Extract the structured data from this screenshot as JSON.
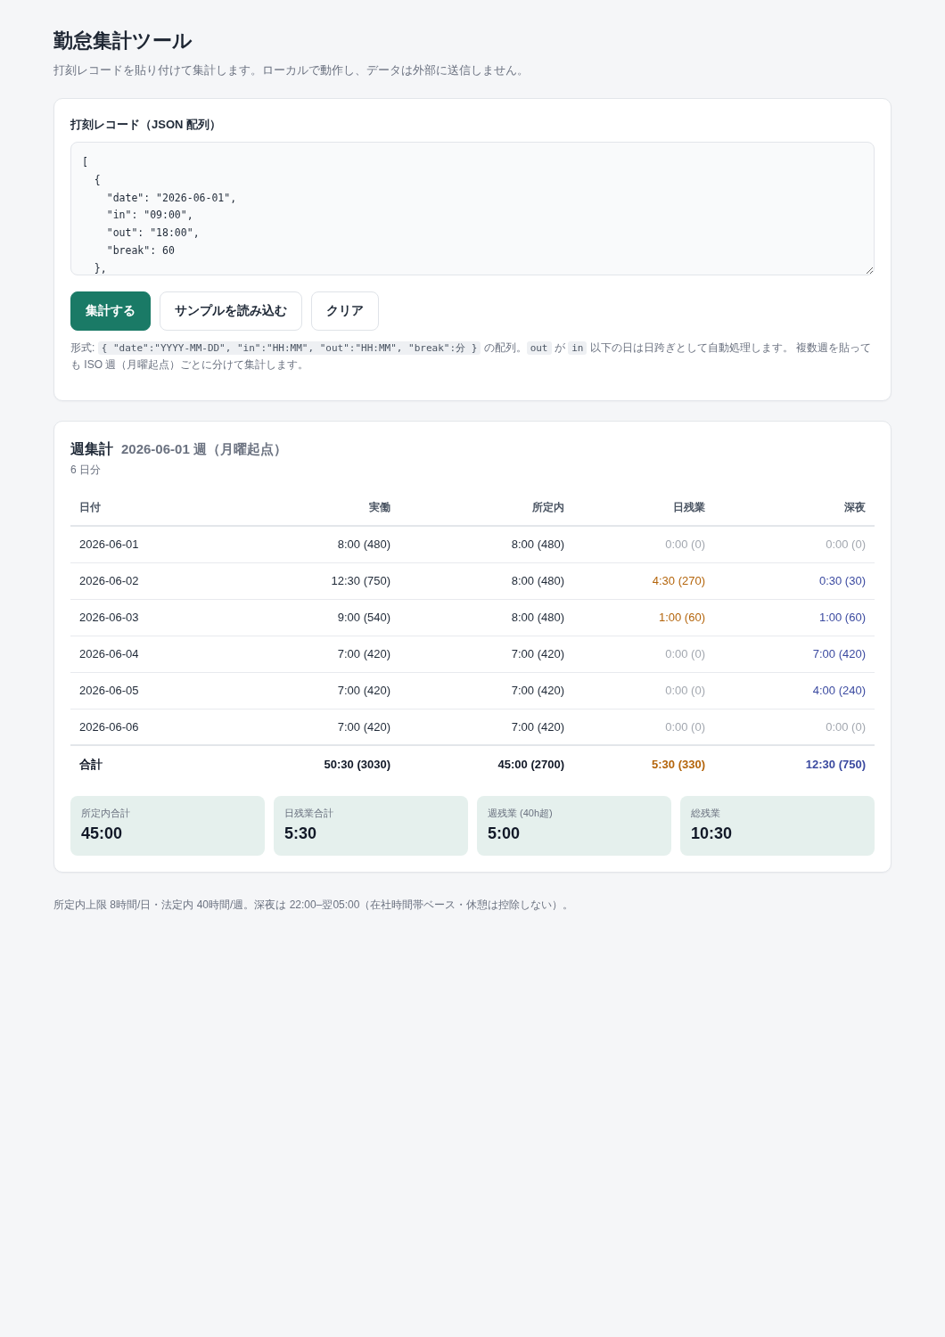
{
  "page": {
    "title": "勤怠集計ツール",
    "subtitle": "打刻レコードを貼り付けて集計します。ローカルで動作し、データは外部に送信しません。"
  },
  "input_card": {
    "label": "打刻レコード（JSON 配列）",
    "records_field": {
      "value": "[\n  {\n    \"date\": \"2026-06-01\",\n    \"in\": \"09:00\",\n    \"out\": \"18:00\",\n    \"break\": 60\n  },"
    },
    "buttons": [
      {
        "label": "集計する",
        "kind": "primary"
      },
      {
        "label": "サンプルを読み込む",
        "kind": "secondary"
      },
      {
        "label": "クリア",
        "kind": "secondary"
      }
    ],
    "hint": [
      {
        "text": "形式: ",
        "kind": "plain"
      },
      {
        "text": "{ \"date\":\"YYYY-MM-DD\", \"in\":\"HH:MM\", \"out\":\"HH:MM\", \"break\":分 }",
        "kind": "code"
      },
      {
        "text": " の配列。",
        "kind": "plain"
      },
      {
        "text": "out",
        "kind": "code"
      },
      {
        "text": " が ",
        "kind": "plain"
      },
      {
        "text": "in",
        "kind": "code"
      },
      {
        "text": " 以下の日は日跨ぎとして自動処理します。 複数週を貼っても ISO 週（月曜起点）ごとに分けて集計します。",
        "kind": "plain"
      }
    ]
  },
  "summary_card": {
    "title": "週集計",
    "week": "2026-06-01 週（月曜起点）",
    "day_count": "6 日分",
    "table": {
      "columns": [
        {
          "label": "日付",
          "kind": "date"
        },
        {
          "label": "実働",
          "kind": "number"
        },
        {
          "label": "所定内",
          "kind": "number"
        },
        {
          "label": "日残業",
          "kind": "overtime"
        },
        {
          "label": "深夜",
          "kind": "night"
        }
      ],
      "rows": [
        {
          "cells": [
            {
              "text": "2026-06-01",
              "muted": false
            },
            {
              "text": "8:00 (480)",
              "muted": false
            },
            {
              "text": "8:00 (480)",
              "muted": false
            },
            {
              "text": "0:00 (0)",
              "muted": true
            },
            {
              "text": "0:00 (0)",
              "muted": true
            }
          ]
        },
        {
          "cells": [
            {
              "text": "2026-06-02",
              "muted": false
            },
            {
              "text": "12:30 (750)",
              "muted": false
            },
            {
              "text": "8:00 (480)",
              "muted": false
            },
            {
              "text": "4:30 (270)",
              "muted": false
            },
            {
              "text": "0:30 (30)",
              "muted": false
            }
          ]
        },
        {
          "cells": [
            {
              "text": "2026-06-03",
              "muted": false
            },
            {
              "text": "9:00 (540)",
              "muted": false
            },
            {
              "text": "8:00 (480)",
              "muted": false
            },
            {
              "text": "1:00 (60)",
              "muted": false
            },
            {
              "text": "1:00 (60)",
              "muted": false
            }
          ]
        },
        {
          "cells": [
            {
              "text": "2026-06-04",
              "muted": false
            },
            {
              "text": "7:00 (420)",
              "muted": false
            },
            {
              "text": "7:00 (420)",
              "muted": false
            },
            {
              "text": "0:00 (0)",
              "muted": true
            },
            {
              "text": "7:00 (420)",
              "muted": false
            }
          ]
        },
        {
          "cells": [
            {
              "text": "2026-06-05",
              "muted": false
            },
            {
              "text": "7:00 (420)",
              "muted": false
            },
            {
              "text": "7:00 (420)",
              "muted": false
            },
            {
              "text": "0:00 (0)",
              "muted": true
            },
            {
              "text": "4:00 (240)",
              "muted": false
            }
          ]
        },
        {
          "cells": [
            {
              "text": "2026-06-06",
              "muted": false
            },
            {
              "text": "7:00 (420)",
              "muted": false
            },
            {
              "text": "7:00 (420)",
              "muted": false
            },
            {
              "text": "0:00 (0)",
              "muted": true
            },
            {
              "text": "0:00 (0)",
              "muted": true
            }
          ]
        }
      ],
      "total": {
        "cells": [
          {
            "text": "合計",
            "muted": false
          },
          {
            "text": "50:30 (3030)",
            "muted": false
          },
          {
            "text": "45:00 (2700)",
            "muted": false
          },
          {
            "text": "5:30 (330)",
            "muted": false
          },
          {
            "text": "12:30 (750)",
            "muted": false
          }
        ]
      }
    },
    "stats": [
      {
        "label": "所定内合計",
        "value": "45:00"
      },
      {
        "label": "日残業合計",
        "value": "5:30"
      },
      {
        "label": "週残業 (40h超)",
        "value": "5:00"
      },
      {
        "label": "総残業",
        "value": "10:30"
      }
    ]
  },
  "footnote": "所定内上限 8時間/日・法定内 40時間/週。深夜は 22:00–翌05:00（在社時間帯ベース・休憩は控除しない）。"
}
